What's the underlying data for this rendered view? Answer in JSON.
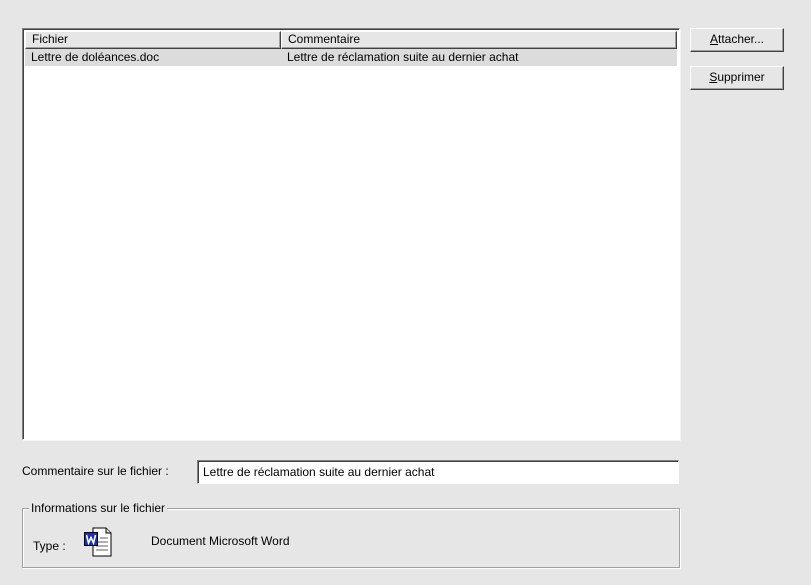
{
  "attachments": {
    "columns": {
      "file": "Fichier",
      "comment": "Commentaire"
    },
    "rows": [
      {
        "file": "Lettre de doléances.doc",
        "comment": "Lettre de réclamation suite au dernier achat"
      }
    ]
  },
  "buttons": {
    "attach": {
      "mnemonic": "A",
      "rest": "ttacher..."
    },
    "delete": {
      "mnemonic": "S",
      "rest": "upprimer"
    }
  },
  "comment_field": {
    "label": "Commentaire sur le fichier :",
    "value": "Lettre de réclamation suite au dernier achat"
  },
  "file_info": {
    "title": "Informations sur le fichier",
    "type_label": "Type :",
    "type_value": "Document Microsoft Word",
    "icon": "word-document-icon"
  },
  "colors": {
    "background": "#e6e6e6",
    "selected_row": "#dcdcdc",
    "word_blue": "#1a2fb8"
  }
}
